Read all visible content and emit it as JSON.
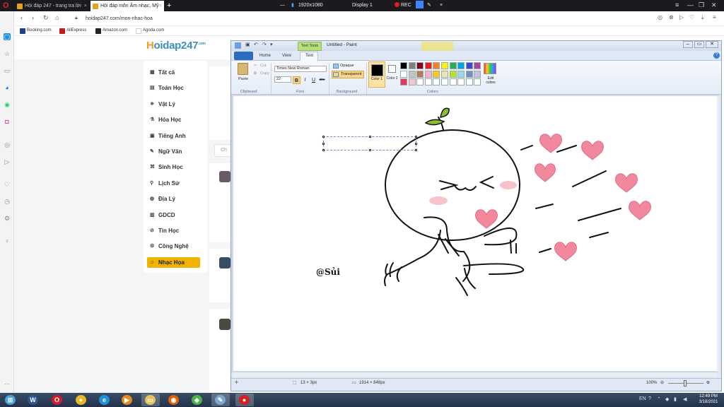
{
  "browser": {
    "tabs": [
      {
        "title": "Hỏi đáp 247 - trang tra lời",
        "active": false
      },
      {
        "title": "Hỏi đáp môn Âm nhạc, Mỹ",
        "active": true
      }
    ],
    "new_tab_glyph": "+",
    "url": "hoidap247.com/mon-nhac-hoa",
    "bookmarks": [
      "Booking.com",
      "AliExpress",
      "Amazon.com",
      "Agoda.com"
    ],
    "recorder": {
      "resolution": "1920x1080",
      "display": "Display 1",
      "rec_label": "REC"
    }
  },
  "site": {
    "logo": {
      "main": "oidap247",
      "first_letter": "H",
      "suffix": ".com"
    },
    "nav_items": [
      {
        "label": "Tất cả",
        "icon": "grid-icon",
        "glyph": "▦",
        "active": false
      },
      {
        "label": "Toán Học",
        "icon": "calculator-icon",
        "glyph": "▤",
        "active": false
      },
      {
        "label": "Vật Lý",
        "icon": "atom-icon",
        "glyph": "⚛",
        "active": false
      },
      {
        "label": "Hóa Học",
        "icon": "flask-icon",
        "glyph": "⚗",
        "active": false
      },
      {
        "label": "Tiếng Anh",
        "icon": "language-icon",
        "glyph": "▣",
        "active": false
      },
      {
        "label": "Ngữ Văn",
        "icon": "pen-icon",
        "glyph": "✎",
        "active": false
      },
      {
        "label": "Sinh Học",
        "icon": "dna-icon",
        "glyph": "⌘",
        "active": false
      },
      {
        "label": "Lịch Sử",
        "icon": "history-icon",
        "glyph": "⚲",
        "active": false
      },
      {
        "label": "Địa Lý",
        "icon": "globe-icon",
        "glyph": "◍",
        "active": false
      },
      {
        "label": "GDCD",
        "icon": "book-icon",
        "glyph": "▥",
        "active": false
      },
      {
        "label": "Tin Học",
        "icon": "computer-icon",
        "glyph": "⊘",
        "active": false
      },
      {
        "label": "Công Nghệ",
        "icon": "gear-icon",
        "glyph": "⚙",
        "active": false
      },
      {
        "label": "Nhạc Họa",
        "icon": "music-icon",
        "glyph": "♫",
        "active": true
      }
    ],
    "search_stub": "Ch"
  },
  "paint": {
    "title": "Untitled - Paint",
    "contextual_tab": "Text Tools",
    "tabs": [
      "Home",
      "View",
      "Text"
    ],
    "clipboard": {
      "paste": "Paste",
      "cut": "Cut",
      "copy": "Copy",
      "group": "Clipboard"
    },
    "font": {
      "family": "Times New Roman",
      "size": "22",
      "group": "Font",
      "bold": "B",
      "italic": "I",
      "underline": "U",
      "strike": "abc"
    },
    "background": {
      "opaque": "Opaque",
      "transparent": "Transparent",
      "group": "Background"
    },
    "colors": {
      "color1_label": "Color 1",
      "color2_label": "Color 2",
      "group": "Colors",
      "edit_label": "Edit colors",
      "palette_row1": [
        "#000000",
        "#7f7f7f",
        "#880015",
        "#ed1c24",
        "#ff7f27",
        "#fff200",
        "#22b14c",
        "#00a2e8",
        "#3f48cc",
        "#a349a4"
      ],
      "palette_row2": [
        "#ffffff",
        "#c3c3c3",
        "#b97a57",
        "#ffaec9",
        "#ffc90e",
        "#efe4b0",
        "#b5e61d",
        "#99d9ea",
        "#7092be",
        "#c8bfe7"
      ],
      "palette_row3": [
        "#e8365a",
        "#f5c6d2",
        "#ffffff",
        "#ffffff",
        "#ffffff",
        "#ffffff",
        "#ffffff",
        "#ffffff",
        "#ffffff",
        "#ffffff"
      ]
    },
    "canvas_text": "@Sủi",
    "status": {
      "selection": "13 × 3px",
      "size": "1914 × 848px",
      "zoom": "100%"
    }
  },
  "taskbar": {
    "apps": [
      {
        "name": "start-button",
        "glyph": "⊞",
        "color": "#4aa0e6"
      },
      {
        "name": "word-app",
        "glyph": "W",
        "color": "#2b579a"
      },
      {
        "name": "opera-app",
        "glyph": "O",
        "color": "#cc1f2b"
      },
      {
        "name": "chrome-app",
        "glyph": "●",
        "color": "#e8b923"
      },
      {
        "name": "ie-app",
        "glyph": "e",
        "color": "#1e90d8"
      },
      {
        "name": "media-app",
        "glyph": "▶",
        "color": "#e58a1f"
      },
      {
        "name": "explorer-app",
        "glyph": "▭",
        "color": "#e8c25a"
      },
      {
        "name": "firefox-app",
        "glyph": "◉",
        "color": "#e66000"
      },
      {
        "name": "green-app",
        "glyph": "◈",
        "color": "#4bb543"
      },
      {
        "name": "paint-app",
        "glyph": "✎",
        "color": "#7aa7d8"
      },
      {
        "name": "recorder-app",
        "glyph": "●",
        "color": "#d42020"
      }
    ],
    "language": "EN",
    "time": "12:49 PM",
    "date": "3/18/2021"
  }
}
